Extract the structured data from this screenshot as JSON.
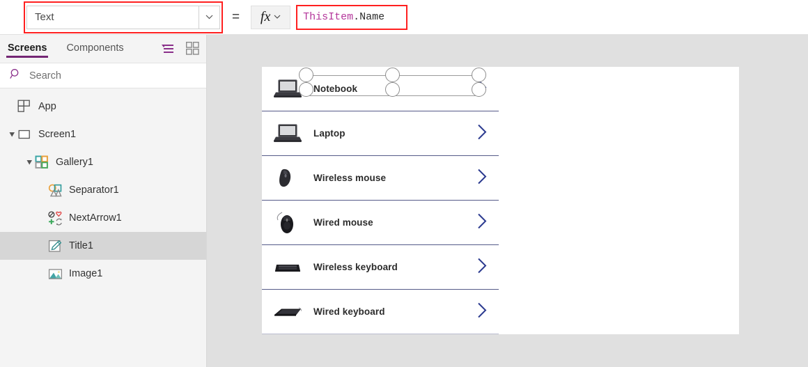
{
  "formula_bar": {
    "property_value": "Text",
    "property_caret_icon": "chevron-down-icon",
    "equals_label": "=",
    "fx_label": "fx",
    "fx_caret_icon": "chevron-down-icon",
    "formula_token_object": "ThisItem",
    "formula_token_property": ".Name",
    "formula_full": "ThisItem.Name"
  },
  "left_panel": {
    "tabs": [
      {
        "label": "Screens",
        "active": true
      },
      {
        "label": "Components",
        "active": false
      }
    ],
    "view_icons": [
      {
        "name": "tree-view-icon"
      },
      {
        "name": "thumbnail-view-icon"
      }
    ],
    "search": {
      "icon": "search-icon",
      "placeholder": "Search",
      "value": ""
    },
    "tree": [
      {
        "label": "App",
        "icon": "app-icon",
        "indent": 0,
        "expander": "none",
        "selected": false
      },
      {
        "label": "Screen1",
        "icon": "screen-icon",
        "indent": 0,
        "expander": "expanded",
        "selected": false
      },
      {
        "label": "Gallery1",
        "icon": "gallery-icon",
        "indent": 1,
        "expander": "expanded",
        "selected": false
      },
      {
        "label": "Separator1",
        "icon": "shapes-icon",
        "indent": 2,
        "expander": "none",
        "selected": false
      },
      {
        "label": "NextArrow1",
        "icon": "icons-group-icon",
        "indent": 2,
        "expander": "none",
        "selected": false
      },
      {
        "label": "Title1",
        "icon": "label-edit-icon",
        "indent": 2,
        "expander": "none",
        "selected": true
      },
      {
        "label": "Image1",
        "icon": "image-icon",
        "indent": 2,
        "expander": "none",
        "selected": false
      }
    ]
  },
  "canvas": {
    "gallery": {
      "items": [
        {
          "title": "Notebook",
          "thumb": "laptop-photo",
          "chevron": "next-arrow-icon",
          "selected": true
        },
        {
          "title": "Laptop",
          "thumb": "laptop-photo",
          "chevron": "next-arrow-icon",
          "selected": false
        },
        {
          "title": "Wireless mouse",
          "thumb": "wireless-mouse-photo",
          "chevron": "next-arrow-icon",
          "selected": false
        },
        {
          "title": "Wired mouse",
          "thumb": "wired-mouse-photo",
          "chevron": "next-arrow-icon",
          "selected": false
        },
        {
          "title": "Wireless keyboard",
          "thumb": "wireless-keyboard-photo",
          "chevron": "next-arrow-icon",
          "selected": false
        },
        {
          "title": "Wired keyboard",
          "thumb": "wired-keyboard-photo",
          "chevron": "next-arrow-icon",
          "selected": false
        }
      ]
    }
  },
  "colors": {
    "accent_purple": "#742774",
    "annotation_red": "#ff2020",
    "chevron_navy": "#2b3a8f",
    "separator_navy": "#545a88",
    "canvas_gray": "#e0e0e0",
    "selected_row_gray": "#d6d6d6",
    "token_magenta": "#b4369b"
  }
}
